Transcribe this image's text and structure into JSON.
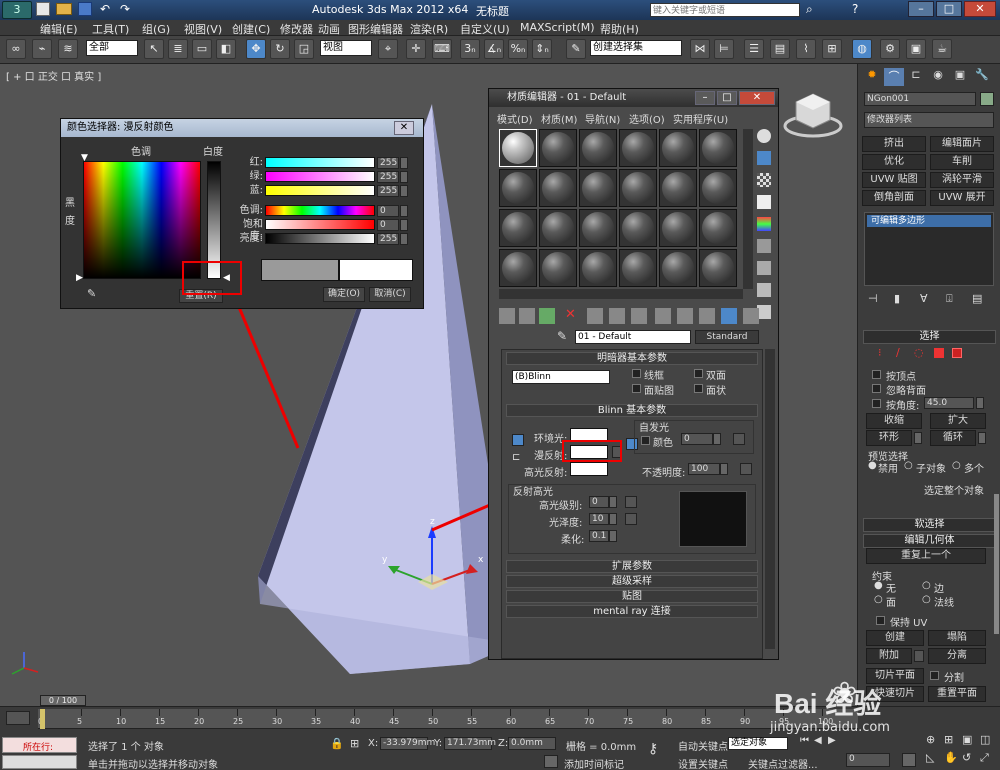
{
  "title_bar": {
    "app_title": "Autodesk 3ds Max  2012 x64",
    "doc_title": "无标题",
    "search_placeholder": "键入关键字或短语"
  },
  "menu": {
    "items": [
      "编辑(E)",
      "工具(T)",
      "组(G)",
      "视图(V)",
      "创建(C)",
      "修改器",
      "动画",
      "图形编辑器",
      "渲染(R)",
      "自定义(U)",
      "MAXScript(M)",
      "帮助(H)"
    ]
  },
  "toolbar": {
    "filter_select": "全部",
    "ref_coord_select": "视图",
    "named_selection": "创建选择集"
  },
  "viewport": {
    "label": "[ + 口 正交 口 真实 ]"
  },
  "color_picker": {
    "title": "颜色选择器: 漫反射颜色",
    "hue_label": "色调",
    "white_label": "白度",
    "black_label": "黑度",
    "sliders": [
      {
        "label": "红:",
        "value": "255"
      },
      {
        "label": "绿:",
        "value": "255"
      },
      {
        "label": "蓝:",
        "value": "255"
      },
      {
        "label": "色调:",
        "value": "0"
      },
      {
        "label": "饱和度:",
        "value": "0"
      },
      {
        "label": "亮度:",
        "value": "255"
      }
    ],
    "reset_button": "重置(R)",
    "ok_button": "确定(O)",
    "cancel_button": "取消(C)"
  },
  "material_editor": {
    "title": "材质编辑器 - 01 - Default",
    "menu": [
      "模式(D)",
      "材质(M)",
      "导航(N)",
      "选项(O)",
      "实用程序(U)"
    ],
    "material_name": "01 - Default",
    "material_type": "Standard",
    "shader_rollout": {
      "header": "明暗器基本参数",
      "shader": "(B)Blinn",
      "checkboxes": [
        "线框",
        "双面",
        "面贴图",
        "面状"
      ]
    },
    "blinn_rollout": {
      "header": "Blinn 基本参数",
      "ambient": "环境光:",
      "diffuse": "漫反射:",
      "specular": "高光反射:",
      "self_illum_header": "自发光",
      "color_label": "颜色",
      "self_illum_value": "0",
      "opacity_label": "不透明度:",
      "opacity_value": "100",
      "spec_header": "反射高光",
      "spec_level_label": "高光级别:",
      "spec_level_value": "0",
      "gloss_label": "光泽度:",
      "gloss_value": "10",
      "soften_label": "柔化:",
      "soften_value": "0.1"
    },
    "rollouts": [
      "扩展参数",
      "超级采样",
      "贴图",
      "mental ray 连接"
    ]
  },
  "command_panel": {
    "object_name": "NGon001",
    "modifier_list": "修改器列表",
    "buttons": [
      "挤出",
      "编辑面片",
      "优化",
      "车削",
      "UVW 贴图",
      "涡轮平滑",
      "倒角剖面",
      "UVW 展开"
    ],
    "stack_item": "可编辑多边形",
    "selection_header": "选择",
    "by_vertex": "按顶点",
    "ignore_backfacing": "忽略背面",
    "by_angle": "按角度:",
    "angle_value": "45.0",
    "shrink": "收缩",
    "grow": "扩大",
    "ring": "环形",
    "loop": "循环",
    "preview_header": "预览选择",
    "preview_options": [
      "禁用",
      "子对象",
      "多个"
    ],
    "whole_object": "选定整个对象",
    "soft_sel_header": "软选择",
    "edit_geo_header": "编辑几何体",
    "repeat_last": "重复上一个",
    "constraint_header": "约束",
    "constraints": [
      "无",
      "边",
      "面",
      "法线"
    ],
    "preserve_uv": "保持 UV",
    "create": "创建",
    "collapse": "塌陷",
    "attach": "附加",
    "detach": "分离",
    "slice_plane": "切片平面",
    "split": "分割",
    "quick_slice": "快速切片",
    "cut": "切割",
    "reset_plane": "重置平面"
  },
  "status": {
    "frame_counter": "0 / 100",
    "ruler_ticks": [
      "0",
      "5",
      "10",
      "15",
      "20",
      "25",
      "30",
      "35",
      "40",
      "45",
      "50",
      "55",
      "60",
      "65",
      "70",
      "75",
      "80",
      "85",
      "90",
      "95",
      "100"
    ],
    "listener_text": "所在行:",
    "selection_status": "选择了 1 个 对象",
    "prompt": "单击并拖动以选择并移动对象",
    "x_value": "-33.979mm",
    "y_value": "171.73mm",
    "z_value": "0.0mm",
    "grid": "栅格 = 0.0mm",
    "add_time_tag": "添加时间标记",
    "auto_key": "自动关键点",
    "set_key": "设置关键点",
    "selected_dropdown": "选定对象",
    "key_filters": "关键点过滤器..."
  },
  "watermark": {
    "brand": "Bai 经验",
    "url": "jingyan.baidu.com"
  }
}
